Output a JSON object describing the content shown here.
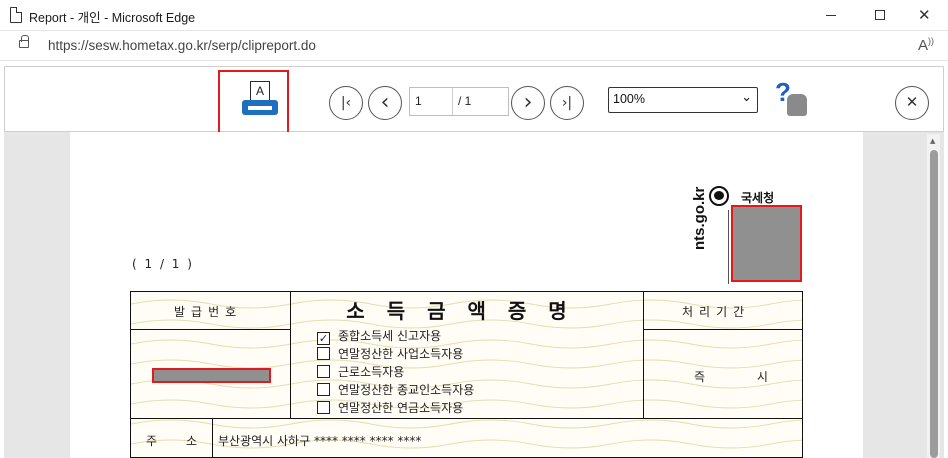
{
  "window": {
    "title": "Report - 개인 - Microsoft Edge",
    "minimize_icon": "minimize-icon",
    "maximize_icon": "maximize-icon",
    "close_glyph": "✕"
  },
  "address": {
    "url": "https://sesw.hometax.go.kr/serp/clipreport.do",
    "read_aloud_label": "A)"
  },
  "toolbar": {
    "print_paper_letter": "A",
    "first_glyph": "|‹",
    "prev_glyph": "‹",
    "next_glyph": "›",
    "last_glyph": "›|",
    "current_page": "1",
    "total_pages": "/ 1",
    "zoom": "100%",
    "help_glyph": "?",
    "close_glyph": "✕",
    "colors": {
      "print_highlight": "#e21a1a",
      "printer": "#1f6fc1",
      "help": "#1f5fbf"
    }
  },
  "document": {
    "nts_domain": "nts.go.kr",
    "nts_office": "국세청",
    "page_count": "( 1 / 1 )",
    "issue_number_label": "발급번호",
    "form_title": "소득금액증명",
    "processing_period_label": "처리기간",
    "processing_period_value": "즉 시",
    "options": [
      {
        "label": "종합소득세 신고자용",
        "checked": "✓"
      },
      {
        "label": "연말정산한 사업소득자용",
        "checked": ""
      },
      {
        "label": "근로소득자용",
        "checked": ""
      },
      {
        "label": "연말정산한 종교인소득자용",
        "checked": ""
      },
      {
        "label": "연말정산한 연금소득자용",
        "checked": ""
      }
    ],
    "address_label_1": "주",
    "address_label_2": "소",
    "address_value": "부산광역시 사하구 **** **** **** ****"
  }
}
